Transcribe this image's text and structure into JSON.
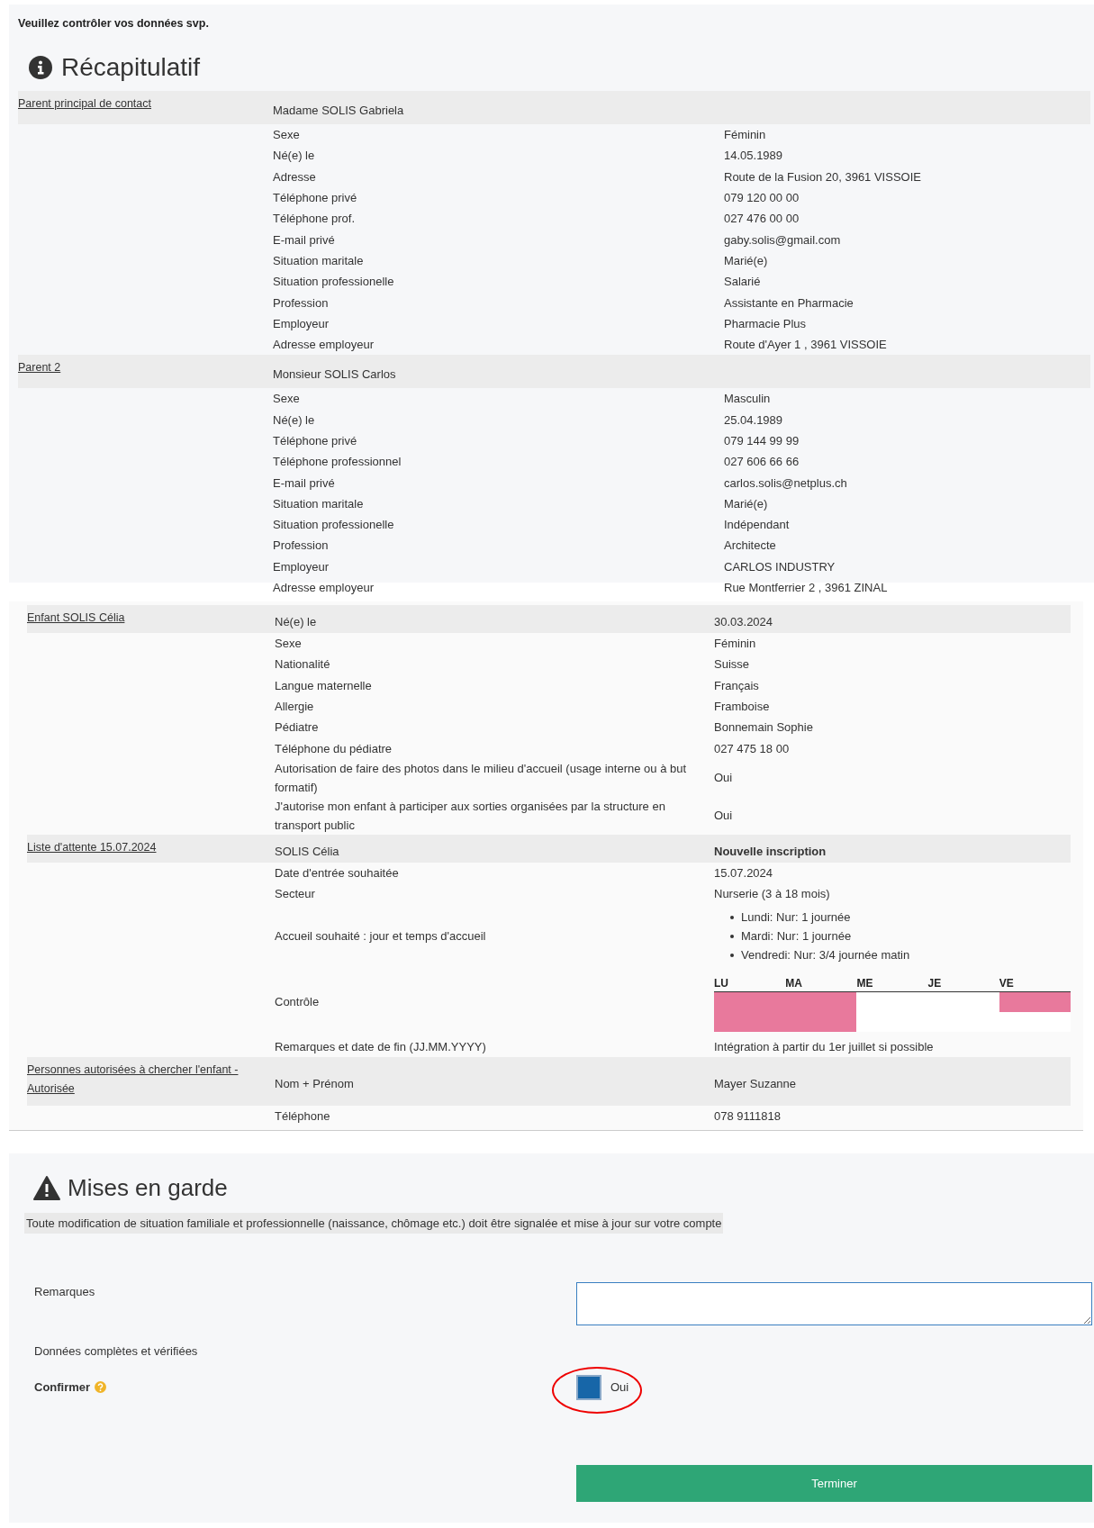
{
  "intro": "Veuillez contrôler vos données svp.",
  "summary": {
    "title": "Récapitulatif",
    "panels": [
      {
        "groups": [
          {
            "link": "Parent principal de contact",
            "rows": [
              {
                "kind": "head",
                "label": "Madame SOLIS Gabriela"
              },
              {
                "kind": "field",
                "label": "Sexe",
                "value": "Féminin"
              },
              {
                "kind": "field",
                "label": "Né(e) le",
                "value": "14.05.1989"
              },
              {
                "kind": "field",
                "label": "Adresse",
                "value": "Route de la Fusion 20, 3961 VISSOIE"
              },
              {
                "kind": "field",
                "label": "Téléphone privé",
                "value": "079 120 00 00"
              },
              {
                "kind": "field",
                "label": "Téléphone prof.",
                "value": "027 476 00 00"
              },
              {
                "kind": "field",
                "label": "E-mail privé",
                "value": "gaby.solis@gmail.com"
              },
              {
                "kind": "field",
                "label": "Situation maritale",
                "value": "Marié(e)"
              },
              {
                "kind": "field",
                "label": "Situation professionelle",
                "value": "Salarié"
              },
              {
                "kind": "field",
                "label": "Profession",
                "value": "Assistante en Pharmacie"
              },
              {
                "kind": "field",
                "label": "Employeur",
                "value": "Pharmacie Plus"
              },
              {
                "kind": "field",
                "label": "Adresse employeur",
                "value": "Route d'Ayer 1 , 3961 VISSOIE"
              }
            ]
          },
          {
            "link": "Parent 2",
            "rows": [
              {
                "kind": "head",
                "label": "Monsieur SOLIS Carlos"
              },
              {
                "kind": "field",
                "label": "Sexe",
                "value": "Masculin"
              },
              {
                "kind": "field",
                "label": "Né(e) le",
                "value": "25.04.1989"
              },
              {
                "kind": "field",
                "label": "Téléphone privé",
                "value": "079 144 99 99"
              },
              {
                "kind": "field",
                "label": "Téléphone professionnel",
                "value": "027 606 66 66"
              },
              {
                "kind": "field",
                "label": "E-mail privé",
                "value": "carlos.solis@netplus.ch"
              },
              {
                "kind": "field",
                "label": "Situation maritale",
                "value": "Marié(e)"
              },
              {
                "kind": "field",
                "label": "Situation professionelle",
                "value": "Indépendant"
              },
              {
                "kind": "field",
                "label": "Profession",
                "value": "Architecte"
              },
              {
                "kind": "field",
                "label": "Employeur",
                "value": "CARLOS INDUSTRY"
              },
              {
                "kind": "field",
                "label": "Adresse employeur",
                "value": "Rue Montferrier 2 , 3961 ZINAL"
              }
            ]
          }
        ]
      },
      {
        "groups": [
          {
            "link": "Enfant SOLIS Célia",
            "rows": [
              {
                "kind": "head",
                "label": "Né(e) le",
                "value": "30.03.2024"
              },
              {
                "kind": "field",
                "label": "Sexe",
                "value": "Féminin"
              },
              {
                "kind": "field",
                "label": "Nationalité",
                "value": "Suisse"
              },
              {
                "kind": "field",
                "label": "Langue maternelle",
                "value": "Français"
              },
              {
                "kind": "field",
                "label": "Allergie",
                "value": "Framboise"
              },
              {
                "kind": "field",
                "label": "Pédiatre",
                "value": "Bonnemain Sophie"
              },
              {
                "kind": "field",
                "label": "Téléphone du pédiatre",
                "value": "027 475 18 00"
              },
              {
                "kind": "field",
                "label": "Autorisation de faire des photos dans le milieu d'accueil (usage interne ou à but formatif)",
                "value": "Oui"
              },
              {
                "kind": "field",
                "label": "J'autorise mon enfant à participer aux sorties organisées par la structure en transport public",
                "value": "Oui"
              }
            ]
          },
          {
            "link": "Liste d'attente 15.07.2024",
            "rows": [
              {
                "kind": "head",
                "label": "SOLIS Célia",
                "value": "Nouvelle inscription",
                "bold": true
              },
              {
                "kind": "field",
                "label": "Date d'entrée souhaitée",
                "value": "15.07.2024"
              },
              {
                "kind": "field",
                "label": "Secteur",
                "value": "Nurserie (3 à 18 mois)"
              },
              {
                "kind": "list",
                "label": "Accueil souhaité : jour et temps d'accueil",
                "items": [
                  "Lundi: Nur: 1 journée",
                  "Mardi: Nur: 1 journée",
                  "Vendredi: Nur: 3/4 journée matin"
                ]
              },
              {
                "kind": "planning",
                "label": "Contrôle",
                "days": [
                  {
                    "label": "LU",
                    "morning": true,
                    "afternoon": true
                  },
                  {
                    "label": "MA",
                    "morning": true,
                    "afternoon": true
                  },
                  {
                    "label": "ME",
                    "morning": false,
                    "afternoon": false
                  },
                  {
                    "label": "JE",
                    "morning": false,
                    "afternoon": false
                  },
                  {
                    "label": "VE",
                    "morning": true,
                    "afternoon": false
                  }
                ]
              },
              {
                "kind": "field",
                "label": "Remarques et date de fin (JJ.MM.YYYY)",
                "value": "Intégration à partir du 1er juillet si possible"
              }
            ]
          },
          {
            "link": "Personnes autorisées à chercher l'enfant - Autorisée",
            "rows": [
              {
                "kind": "head",
                "label": "Nom + Prénom",
                "value": "Mayer Suzanne"
              },
              {
                "kind": "field",
                "label": "Téléphone",
                "value": "078 9111818"
              }
            ]
          }
        ]
      }
    ]
  },
  "warnings": {
    "title": "Mises en garde",
    "notice": "Toute modification de situation familiale et professionnelle (naissance, chômage etc.) doit être signalée et mise à jour sur votre compte"
  },
  "form": {
    "remarks_label": "Remarques",
    "complete_label": "Données complètes et vérifiées",
    "confirm_label": "Confirmer",
    "confirm": {
      "label": "Oui",
      "checked": true,
      "highlighted": true
    },
    "submit": "Terminer"
  }
}
